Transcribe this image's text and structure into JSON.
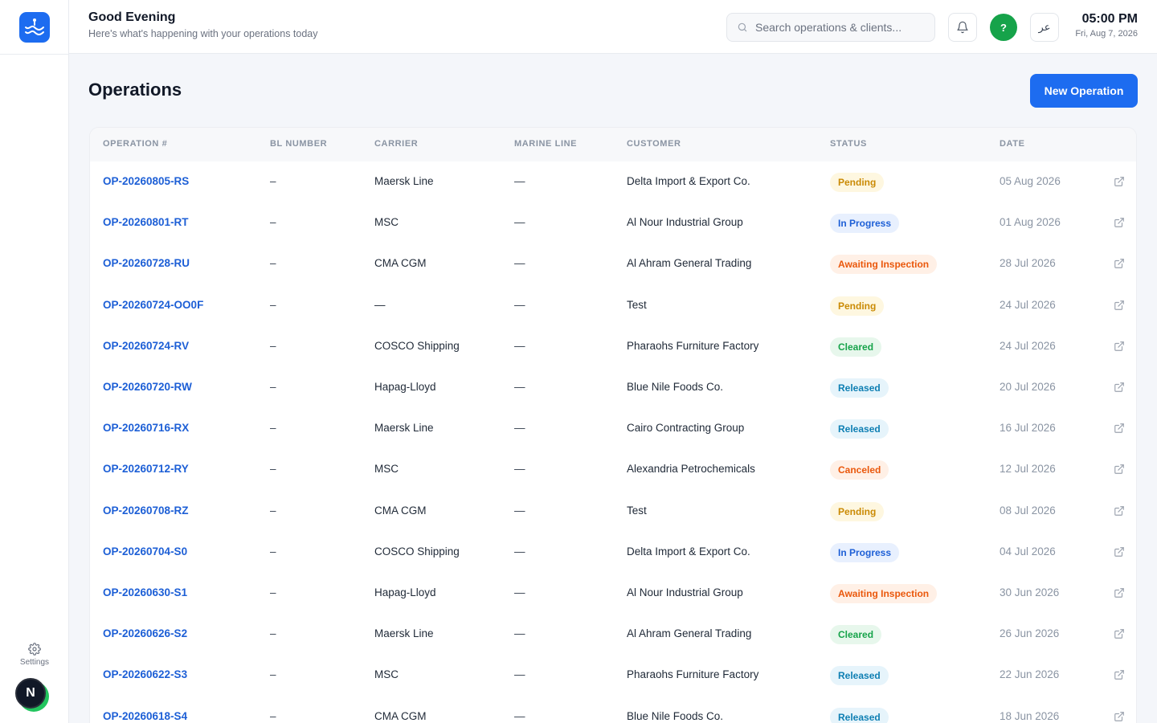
{
  "header": {
    "greeting": "Good Evening",
    "subtitle": "Here's what's happening with your operations today",
    "search_placeholder": "Search operations & clients...",
    "lang_label": "عر",
    "help_label": "?",
    "time": "05:00 PM",
    "date": "Fri, Aug 7, 2026"
  },
  "sidebar": {
    "settings_label": "Settings",
    "user_initial": "N"
  },
  "page": {
    "title": "Operations",
    "new_button_label": "New Operation"
  },
  "table": {
    "columns": [
      "OPERATION #",
      "BL NUMBER",
      "CARRIER",
      "MARINE LINE",
      "CUSTOMER",
      "STATUS",
      "DATE"
    ],
    "rows": [
      {
        "id": "OP-20260805-RS",
        "bl": "–",
        "carrier": "Maersk Line",
        "marine": "—",
        "customer": "Delta Import & Export Co.",
        "status": "Pending",
        "date": "05 Aug 2026"
      },
      {
        "id": "OP-20260801-RT",
        "bl": "–",
        "carrier": "MSC",
        "marine": "—",
        "customer": "Al Nour Industrial Group",
        "status": "In Progress",
        "date": "01 Aug 2026"
      },
      {
        "id": "OP-20260728-RU",
        "bl": "–",
        "carrier": "CMA CGM",
        "marine": "—",
        "customer": "Al Ahram General Trading",
        "status": "Awaiting Inspection",
        "date": "28 Jul 2026"
      },
      {
        "id": "OP-20260724-OO0F",
        "bl": "–",
        "carrier": "—",
        "marine": "—",
        "customer": "Test",
        "status": "Pending",
        "date": "24 Jul 2026"
      },
      {
        "id": "OP-20260724-RV",
        "bl": "–",
        "carrier": "COSCO Shipping",
        "marine": "—",
        "customer": "Pharaohs Furniture Factory",
        "status": "Cleared",
        "date": "24 Jul 2026"
      },
      {
        "id": "OP-20260720-RW",
        "bl": "–",
        "carrier": "Hapag-Lloyd",
        "marine": "—",
        "customer": "Blue Nile Foods Co.",
        "status": "Released",
        "date": "20 Jul 2026"
      },
      {
        "id": "OP-20260716-RX",
        "bl": "–",
        "carrier": "Maersk Line",
        "marine": "—",
        "customer": "Cairo Contracting Group",
        "status": "Released",
        "date": "16 Jul 2026"
      },
      {
        "id": "OP-20260712-RY",
        "bl": "–",
        "carrier": "MSC",
        "marine": "—",
        "customer": "Alexandria Petrochemicals",
        "status": "Canceled",
        "date": "12 Jul 2026"
      },
      {
        "id": "OP-20260708-RZ",
        "bl": "–",
        "carrier": "CMA CGM",
        "marine": "—",
        "customer": "Test",
        "status": "Pending",
        "date": "08 Jul 2026"
      },
      {
        "id": "OP-20260704-S0",
        "bl": "–",
        "carrier": "COSCO Shipping",
        "marine": "—",
        "customer": "Delta Import & Export Co.",
        "status": "In Progress",
        "date": "04 Jul 2026"
      },
      {
        "id": "OP-20260630-S1",
        "bl": "–",
        "carrier": "Hapag-Lloyd",
        "marine": "—",
        "customer": "Al Nour Industrial Group",
        "status": "Awaiting Inspection",
        "date": "30 Jun 2026"
      },
      {
        "id": "OP-20260626-S2",
        "bl": "–",
        "carrier": "Maersk Line",
        "marine": "—",
        "customer": "Al Ahram General Trading",
        "status": "Cleared",
        "date": "26 Jun 2026"
      },
      {
        "id": "OP-20260622-S3",
        "bl": "–",
        "carrier": "MSC",
        "marine": "—",
        "customer": "Pharaohs Furniture Factory",
        "status": "Released",
        "date": "22 Jun 2026"
      },
      {
        "id": "OP-20260618-S4",
        "bl": "–",
        "carrier": "CMA CGM",
        "marine": "—",
        "customer": "Blue Nile Foods Co.",
        "status": "Released",
        "date": "18 Jun 2026"
      }
    ]
  },
  "status_colors": {
    "Pending": {
      "bg": "#fef7e0",
      "fg": "#ca8a04"
    },
    "In Progress": {
      "bg": "#e8f0fe",
      "fg": "#1d5fd6"
    },
    "Awaiting Inspection": {
      "bg": "#fff0e6",
      "fg": "#ea580c"
    },
    "Cleared": {
      "bg": "#e7f7ec",
      "fg": "#16a34a"
    },
    "Released": {
      "bg": "#e6f4fb",
      "fg": "#0e7fb3"
    },
    "Canceled": {
      "bg": "#fff0e6",
      "fg": "#ea580c"
    }
  },
  "colors": {
    "accent": "#1d6cf0",
    "link": "#1d5fd6"
  },
  "icons": [
    "logo-wave-icon",
    "search-icon",
    "bell-icon",
    "gear-icon",
    "external-link-icon"
  ]
}
